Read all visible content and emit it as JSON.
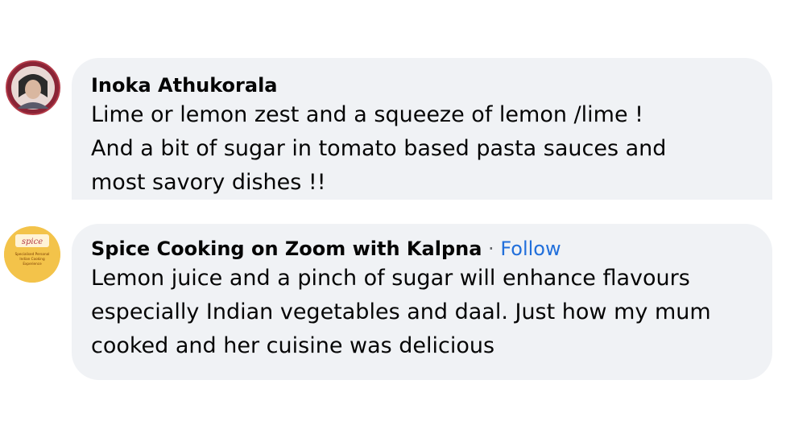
{
  "comments": [
    {
      "author": "Inoka Athukorala",
      "lines": [
        "Lime or lemon zest and a squeeze of lemon /lime !",
        "And a bit of sugar in tomato based pasta sauces and",
        "most savory dishes !!"
      ],
      "avatar_icon": "profile-photo-avatar"
    },
    {
      "author": "Spice Cooking on Zoom with Kalpna",
      "separator": " · ",
      "follow_label": "Follow",
      "lines": [
        "Lemon juice and a pinch of sugar will enhance flavours",
        "especially Indian vegetables and daal. Just how my mum",
        "cooked and her cuisine was delicious"
      ],
      "avatar_icon": "spice-logo-avatar",
      "avatar_text": "Specialised Personal Indian Cooking Experience",
      "avatar_logo": "spice"
    }
  ],
  "colors": {
    "bubble_bg": "#f0f2f5",
    "text": "#050505",
    "link": "#216fdb",
    "muted": "#65676b"
  }
}
